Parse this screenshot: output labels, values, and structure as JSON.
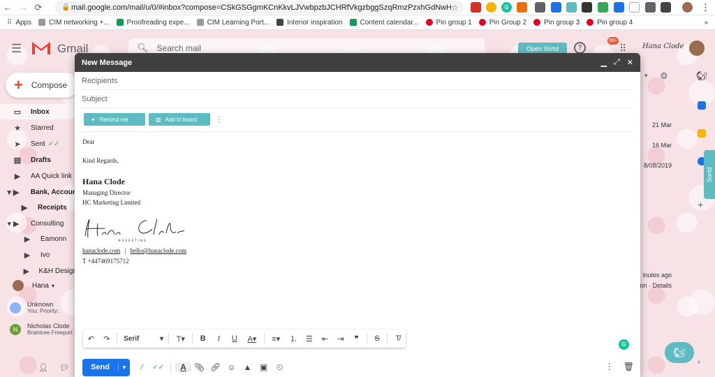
{
  "browser": {
    "url": "mail.google.com/mail/u/0/#inbox?compose=CSkGSGgmKCnKkvLJVwbpzbJCHRfVkgzbggSzqRmzPzxhGdNwHm...",
    "bookmarks": [
      "Apps",
      "CIM networking +...",
      "Proofreading expe...",
      "CIM Learning Port...",
      "Interior inspiration",
      "Content calendar...",
      "Pin group 1",
      "Pin Group 2",
      "Pin group 3",
      "Pin group 4"
    ]
  },
  "gmail": {
    "logo_text": "Gmail",
    "search_placeholder": "Search mail",
    "sortd_button": "Open Sortd",
    "notification_badge": "99+",
    "compose_label": "Compose",
    "sidebar": [
      {
        "label": "Inbox",
        "icon": "inbox-icon",
        "bold": true,
        "active": true
      },
      {
        "label": "Starred",
        "icon": "star-icon"
      },
      {
        "label": "Sent",
        "icon": "send-icon"
      },
      {
        "label": "Drafts",
        "icon": "draft-icon",
        "bold": true
      },
      {
        "label": "AA Quick link",
        "icon": "label-icon"
      },
      {
        "label": "Bank, Accoun",
        "icon": "label-icon",
        "bold": true
      },
      {
        "label": "Receipts",
        "icon": "label-icon",
        "bold": true
      },
      {
        "label": "Consulting",
        "icon": "label-icon"
      },
      {
        "label": "Eamonn",
        "icon": "label-icon"
      },
      {
        "label": "Ivo",
        "icon": "label-icon"
      },
      {
        "label": "K&H Design",
        "icon": "label-icon"
      },
      {
        "label": "Hana",
        "icon": "avatar-icon"
      }
    ],
    "chat": [
      {
        "name": "Unknown",
        "sub": "You: Priority:"
      },
      {
        "name": "Nicholas Clode",
        "sub": "Braintree Freeport"
      }
    ],
    "dates": [
      "21 Mar",
      "16 Mar",
      "8/08/2019",
      "inutes ago",
      "on · Details"
    ],
    "sortd_tab": "Sortd"
  },
  "compose": {
    "title": "New Message",
    "recipients_placeholder": "Recipients",
    "subject_placeholder": "Subject",
    "remind_me": "Remind me",
    "add_to_board": "Add to board",
    "body": {
      "greeting": "Dear",
      "closing": "Kind Regards,",
      "name": "Hana Clode",
      "job_title": "Managing Director",
      "company": "HC Marketing Limited",
      "signature_script": "Hana Clode",
      "signature_caption": "MARKETING",
      "website": "hanaclode.com",
      "separator": "|",
      "email": "hello@hanaclode.com",
      "phone": "T +447469175712"
    },
    "font": "Serif",
    "send_label": "Send"
  }
}
